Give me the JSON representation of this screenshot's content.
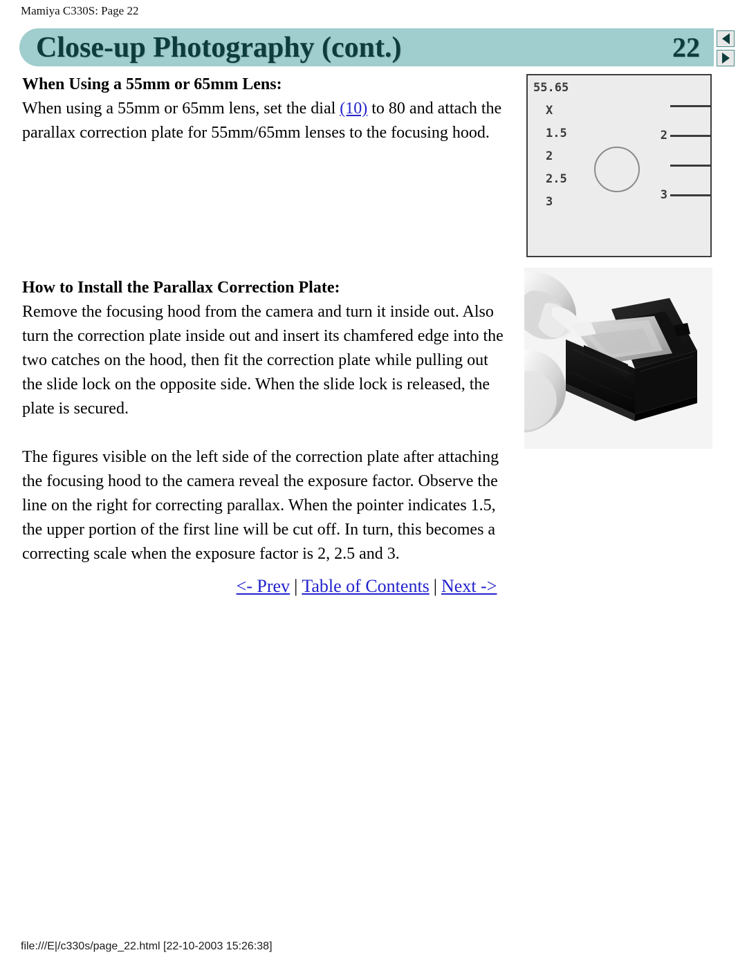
{
  "document": {
    "breadcrumb": "Mamiya C330S: Page 22",
    "footer": "file:///E|/c330s/page_22.html [22-10-2003 15:26:38]"
  },
  "header": {
    "title": "Close-up Photography (cont.)",
    "page_number": "22",
    "band_color": "#a0cdcd",
    "title_color": "#0d3c3c",
    "prev_arrow": "◀",
    "next_arrow": "▶"
  },
  "sections": [
    {
      "heading": "When Using a 55mm or 65mm Lens:",
      "paragraph_pre": "When using a 55mm or 65mm lens, set the dial ",
      "link": "(10)",
      "paragraph_post": " to 80 and attach the parallax correction plate for 55mm/65mm lenses to the focusing hood."
    },
    {
      "heading": "How to Install the Parallax Correction Plate:",
      "paragraph": "Remove the focusing hood from the camera and turn it inside out. Also turn the correction plate inside out and insert its chamfered edge into the two catches on the hood, then fit the correction plate while pulling out the slide lock on the opposite side. When the slide lock is released, the plate is secured."
    },
    {
      "paragraph": "The figures visible on the left side of the correction plate after attaching the focusing hood to the camera reveal the exposure factor. Observe the line on the right for correcting parallax. When the pointer indicates 1.5, the upper portion of the first line will be cut off. In turn, this becomes a correcting scale when the exposure factor is 2, 2.5 and 3."
    }
  ],
  "bottom_nav": {
    "prev": "<- Prev",
    "toc": "Table of Contents",
    "next": "Next ->",
    "separator": "|",
    "link_color": "#2222cc"
  },
  "figures": {
    "plate_diagram": {
      "caption_alt": "Parallax correction plate scale diagram",
      "left_scale": [
        "55.65",
        "X",
        "1.5",
        "2",
        "2.5",
        "3"
      ],
      "right_tick_labels": [
        "",
        "2",
        "",
        "3"
      ],
      "background_color": "#ececec",
      "line_color": "#3a3a3a"
    },
    "install_photo": {
      "caption_alt": "Hands installing the parallax correction plate into the focusing hood"
    }
  }
}
